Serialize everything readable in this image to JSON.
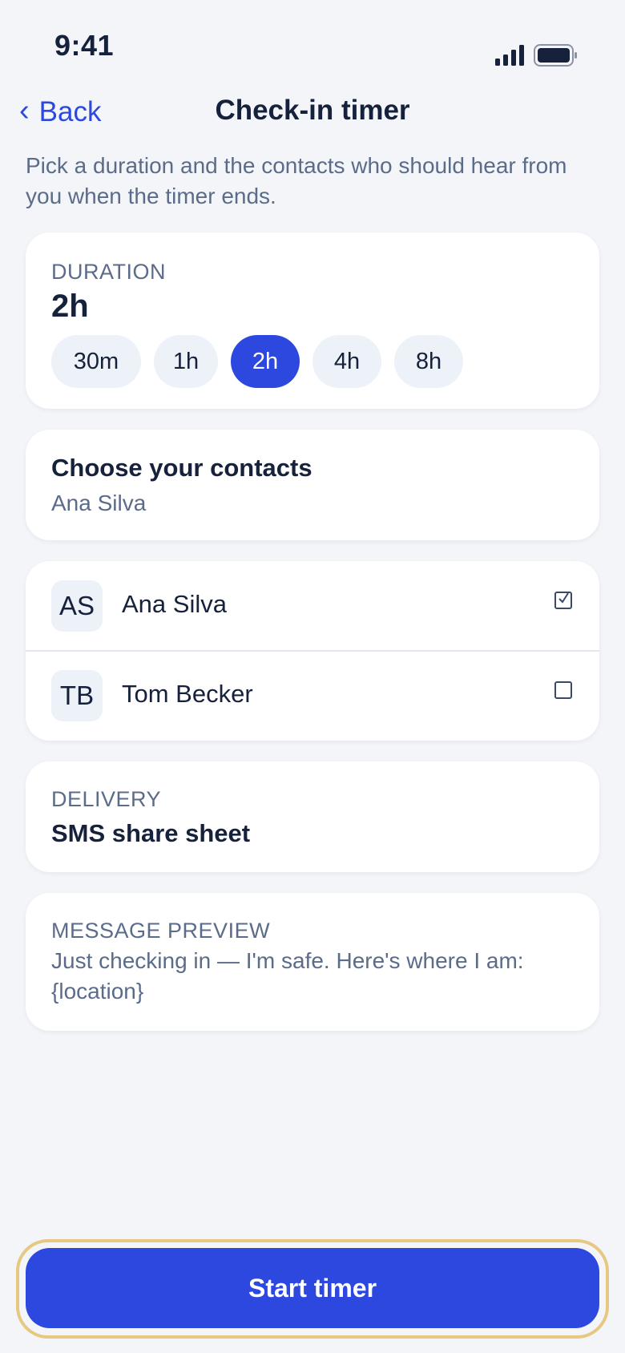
{
  "status_bar": {
    "time": "9:41",
    "signal_icon": "signal-bars-icon",
    "battery_icon": "battery-full-icon"
  },
  "nav": {
    "back_label": "Back",
    "back_icon": "chevron-left-icon",
    "title": "Check-in timer"
  },
  "intro": "Pick a duration and the contacts who should hear from you when the timer ends.",
  "duration": {
    "label": "DURATION",
    "value": "2h",
    "options": [
      "30m",
      "1h",
      "2h",
      "4h",
      "8h"
    ],
    "selected": "2h"
  },
  "contacts": {
    "title": "Choose your contacts",
    "summary": "Ana Silva",
    "list": [
      {
        "initials": "AS",
        "name": "Ana Silva",
        "checked": true
      },
      {
        "initials": "TB",
        "name": "Tom Becker",
        "checked": false
      }
    ]
  },
  "delivery": {
    "label": "DELIVERY",
    "value": "SMS share sheet"
  },
  "preview": {
    "label": "MESSAGE PREVIEW",
    "text": "Just checking in — I'm safe. Here's where I am: {location}"
  },
  "start_button": {
    "label": "Start timer"
  },
  "colors": {
    "accent": "#2c48de",
    "background": "#f3f5f9",
    "focus_outline": "#e6c882",
    "text_primary": "#16213b",
    "text_secondary": "#5b6c8a"
  }
}
